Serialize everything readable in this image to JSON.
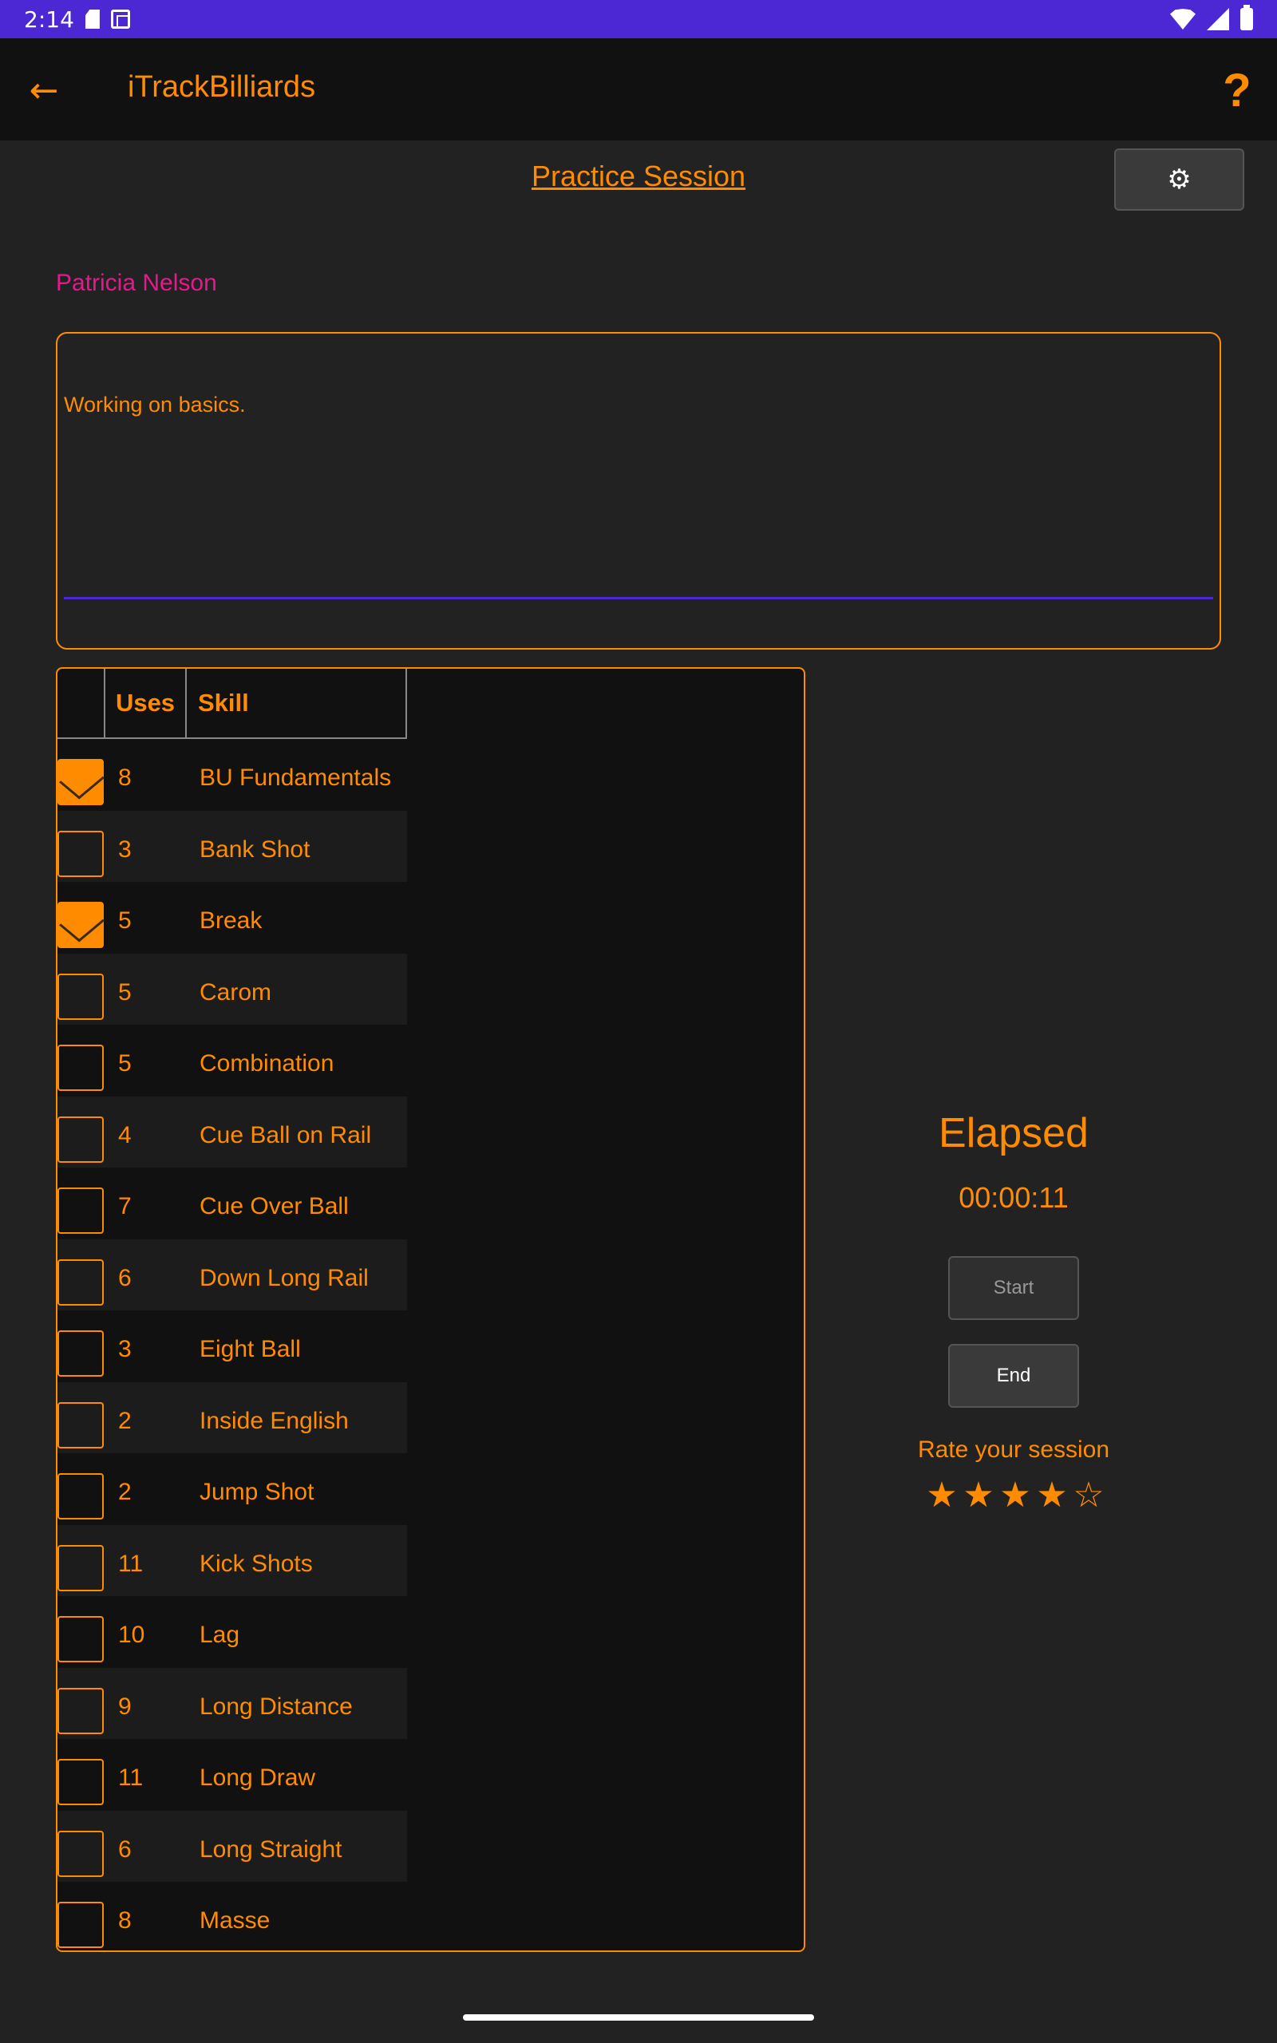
{
  "status_bar": {
    "time": "2:14"
  },
  "app_bar": {
    "title": "iTrackBilliards",
    "help_label": "?",
    "back_label": "←"
  },
  "page": {
    "title": "Practice Session",
    "settings_icon": "⚙",
    "player_name": "Patricia Nelson",
    "notes": "Working on basics."
  },
  "skills_table": {
    "headers": {
      "uses": "Uses",
      "skill": "Skill"
    },
    "rows": [
      {
        "uses": "8",
        "skill": "BU Fundamentals",
        "checked": true
      },
      {
        "uses": "3",
        "skill": "Bank Shot",
        "checked": false
      },
      {
        "uses": "5",
        "skill": "Break",
        "checked": true
      },
      {
        "uses": "5",
        "skill": "Carom",
        "checked": false
      },
      {
        "uses": "5",
        "skill": "Combination",
        "checked": false
      },
      {
        "uses": "4",
        "skill": "Cue Ball on Rail",
        "checked": false
      },
      {
        "uses": "7",
        "skill": "Cue Over Ball",
        "checked": false
      },
      {
        "uses": "6",
        "skill": "Down Long Rail",
        "checked": false
      },
      {
        "uses": "3",
        "skill": "Eight Ball",
        "checked": false
      },
      {
        "uses": "2",
        "skill": "Inside English",
        "checked": false
      },
      {
        "uses": "2",
        "skill": "Jump Shot",
        "checked": false
      },
      {
        "uses": "11",
        "skill": "Kick Shots",
        "checked": false
      },
      {
        "uses": "10",
        "skill": "Lag",
        "checked": false
      },
      {
        "uses": "9",
        "skill": "Long Distance",
        "checked": false
      },
      {
        "uses": "11",
        "skill": "Long Draw",
        "checked": false
      },
      {
        "uses": "6",
        "skill": "Long Straight",
        "checked": false
      },
      {
        "uses": "8",
        "skill": "Masse",
        "checked": false
      }
    ]
  },
  "timer": {
    "label": "Elapsed",
    "value": "00:00:11",
    "start_label": "Start",
    "end_label": "End"
  },
  "rating": {
    "label": "Rate your session",
    "value": 4,
    "max": 5
  },
  "colors": {
    "accent": "#ff8c00",
    "status_bar": "#4c28d4",
    "player_name": "#e6198c",
    "background": "#222222"
  }
}
